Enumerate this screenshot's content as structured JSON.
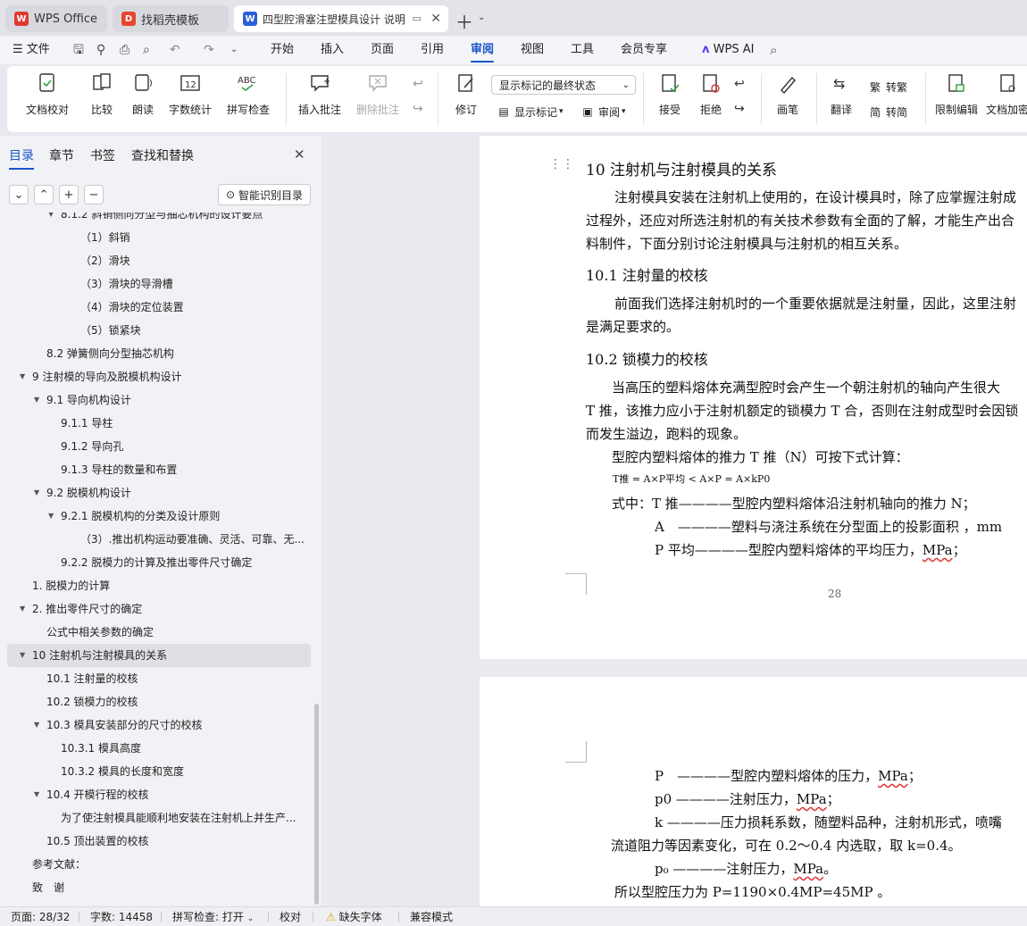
{
  "tabs": [
    {
      "label": "WPS Office",
      "icon": "wps-logo-icon"
    },
    {
      "label": "找稻壳模板",
      "icon": "docer-icon"
    },
    {
      "label": "四型腔滑塞注塑模具设计 说明",
      "icon": "word-doc-icon"
    }
  ],
  "menu": {
    "file": "文件",
    "items": [
      "开始",
      "插入",
      "页面",
      "引用",
      "审阅",
      "视图",
      "工具",
      "会员专享"
    ],
    "active": "审阅",
    "ai": "WPS AI"
  },
  "ribbon": {
    "doc_proof": "文档校对",
    "compare": "比较",
    "read_aloud": "朗读",
    "word_count": "字数统计",
    "spell_check": "拼写检查",
    "insert_comment": "插入批注",
    "delete_comment": "删除批注",
    "revise": "修订",
    "markup_select": "显示标记的最终状态",
    "show_markup": "显示标记",
    "review": "审阅",
    "accept": "接受",
    "reject": "拒绝",
    "pen": "画笔",
    "translate": "翻译",
    "to_traditional": "转繁",
    "to_simplified": "转简",
    "restrict_edit": "限制编辑",
    "doc_encrypt": "文档加密"
  },
  "sidebar": {
    "tabs": [
      "目录",
      "章节",
      "书签",
      "查找和替换"
    ],
    "active_tab": "目录",
    "smart_btn": "智能识别目录",
    "toc": [
      {
        "text": "8.1.2 斜销侧向分型与抽芯机构的设计要点",
        "level": 3,
        "tri": true
      },
      {
        "text": "（1）斜销",
        "level": 4
      },
      {
        "text": "（2）滑块",
        "level": 4
      },
      {
        "text": "（3）滑块的导滑槽",
        "level": 4
      },
      {
        "text": "（4）滑块的定位装置",
        "level": 4
      },
      {
        "text": "（5）锁紧块",
        "level": 4
      },
      {
        "text": "8.2 弹簧侧向分型抽芯机构",
        "level": 2
      },
      {
        "text": "9  注射模的导向及脱模机构设计",
        "level": 1,
        "tri": true
      },
      {
        "text": "9.1  导向机构设计",
        "level": 2,
        "tri": true
      },
      {
        "text": "9.1.1  导柱",
        "level": 3
      },
      {
        "text": "9.1.2  导向孔",
        "level": 3
      },
      {
        "text": "9.1.3  导柱的数量和布置",
        "level": 3
      },
      {
        "text": "9.2  脱模机构设计",
        "level": 2,
        "tri": true
      },
      {
        "text": "9.2.1  脱模机构的分类及设计原则",
        "level": 3,
        "tri": true
      },
      {
        "text": "（3）.推出机构运动要准确、灵活、可靠、无...",
        "level": 4
      },
      {
        "text": "9.2.2  脱模力的计算及推出零件尺寸确定",
        "level": 3
      },
      {
        "text": "1. 脱模力的计算",
        "level": 1
      },
      {
        "text": "2. 推出零件尺寸的确定",
        "level": 1,
        "tri": true
      },
      {
        "text": "公式中相关参数的确定",
        "level": 2
      },
      {
        "text": "10  注射机与注射模具的关系",
        "level": 1,
        "tri": true,
        "selected": true
      },
      {
        "text": "10.1  注射量的校核",
        "level": 2
      },
      {
        "text": "10.2  锁模力的校核",
        "level": 2
      },
      {
        "text": "10.3  模具安装部分的尺寸的校核",
        "level": 2,
        "tri": true
      },
      {
        "text": "10.3.1  模具高度",
        "level": 3
      },
      {
        "text": "10.3.2  模具的长度和宽度",
        "level": 3
      },
      {
        "text": "10.4  开模行程的校核",
        "level": 2,
        "tri": true
      },
      {
        "text": "为了使注射模具能顺利地安装在注射机上并生产...",
        "level": 3
      },
      {
        "text": "10.5  顶出装置的校核",
        "level": 2
      },
      {
        "text": "参考文献：",
        "level": 1
      },
      {
        "text": "致　谢",
        "level": 1
      }
    ]
  },
  "doc": {
    "heading10": "10  注射机与注射模具的关系",
    "p1a": "注射模具安装在注射机上使用的，在设计模具时，除了应掌握注射成",
    "p1b": "过程外，还应对所选注射机的有关技术参数有全面的了解，才能生产出合",
    "p1c": "料制件，下面分别讨论注射模具与注射机的相互关系。",
    "h101": "10.1  注射量的校核",
    "p2a": "前面我们选择注射机时的一个重要依据就是注射量，因此，这里注射",
    "p2b": "是满足要求的。",
    "h102": "10.2  锁模力的校核",
    "p3a": "当高压的塑料熔体充满型腔时会产生一个朝注射机的轴向产生很大",
    "p3b": "T 推，该推力应小于注射机额定的锁模力 T 合，否则在注射成型时会因锁",
    "p3c": "而发生溢边，跑料的现象。",
    "p4": "型腔内塑料熔体的推力 T 推（N）可按下式计算：",
    "formula": "T推 = A×P平均 < A×P = A×kP0",
    "f_lines": [
      "式中：T 推————型腔内塑料熔体沿注射机轴向的推力 N；",
      "A　————塑料与浇注系统在分型面上的投影面积 ，mm",
      "P 平均————型腔内塑料熔体的平均压力，MPa；"
    ],
    "page_num": "28",
    "p2_lines": [
      "P　————型腔内塑料熔体的压力，MPa；",
      "p0 ————注射压力，MPa；",
      "k ————压力损耗系数，随塑料品种，注射机形式，喷嘴",
      "流道阻力等因素变化，可在 0.2～0.4 内选取，取 k=0.4。",
      "p₀ ————注射压力，MPa。",
      "所以型腔压力为 P=1190×0.4MP=45MP 。"
    ]
  },
  "status": {
    "page": "页面: 28/32",
    "words": "字数: 14458",
    "spell": "拼写检查: 打开",
    "proof": "校对",
    "missing_font": "缺失字体",
    "compat": "兼容模式"
  }
}
